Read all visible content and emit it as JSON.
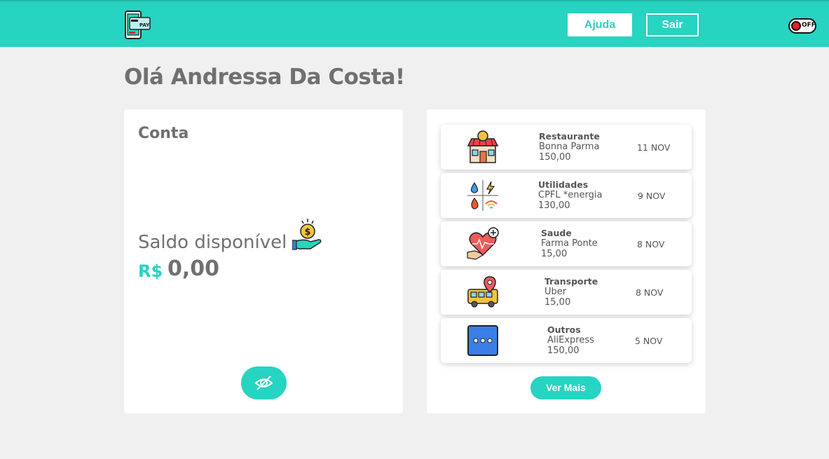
{
  "header": {
    "logo_text": "PAY",
    "help_label": "Ajuda",
    "exit_label": "Sair",
    "toggle_label": "OFF"
  },
  "greeting": "Olá Andressa Da Costa!",
  "account": {
    "title": "Conta",
    "balance_label": "Saldo disponível",
    "currency": "R$",
    "amount": "0,00"
  },
  "transactions": [
    {
      "category": "Restaurante",
      "merchant": "Bonna Parma",
      "value": "150,00",
      "date": "11 NOV",
      "icon": "restaurant-icon"
    },
    {
      "category": "Utilidades",
      "merchant": "CPFL *energia",
      "value": "130,00",
      "date": "9 NOV",
      "icon": "utilities-icon"
    },
    {
      "category": "Saude",
      "merchant": "Farma Ponte",
      "value": "15,00",
      "date": "8 NOV",
      "icon": "health-icon"
    },
    {
      "category": "Transporte",
      "merchant": "Uber",
      "value": "15,00",
      "date": "8 NOV",
      "icon": "bus-icon"
    },
    {
      "category": "Outros",
      "merchant": "AliExpress",
      "value": "150,00",
      "date": "5 NOV",
      "icon": "more-icon"
    }
  ],
  "see_more_label": "Ver Mais",
  "colors": {
    "accent": "#27d3c1",
    "text": "#707070",
    "background": "#f0f0f0",
    "toggle_off": "#e41f26"
  }
}
